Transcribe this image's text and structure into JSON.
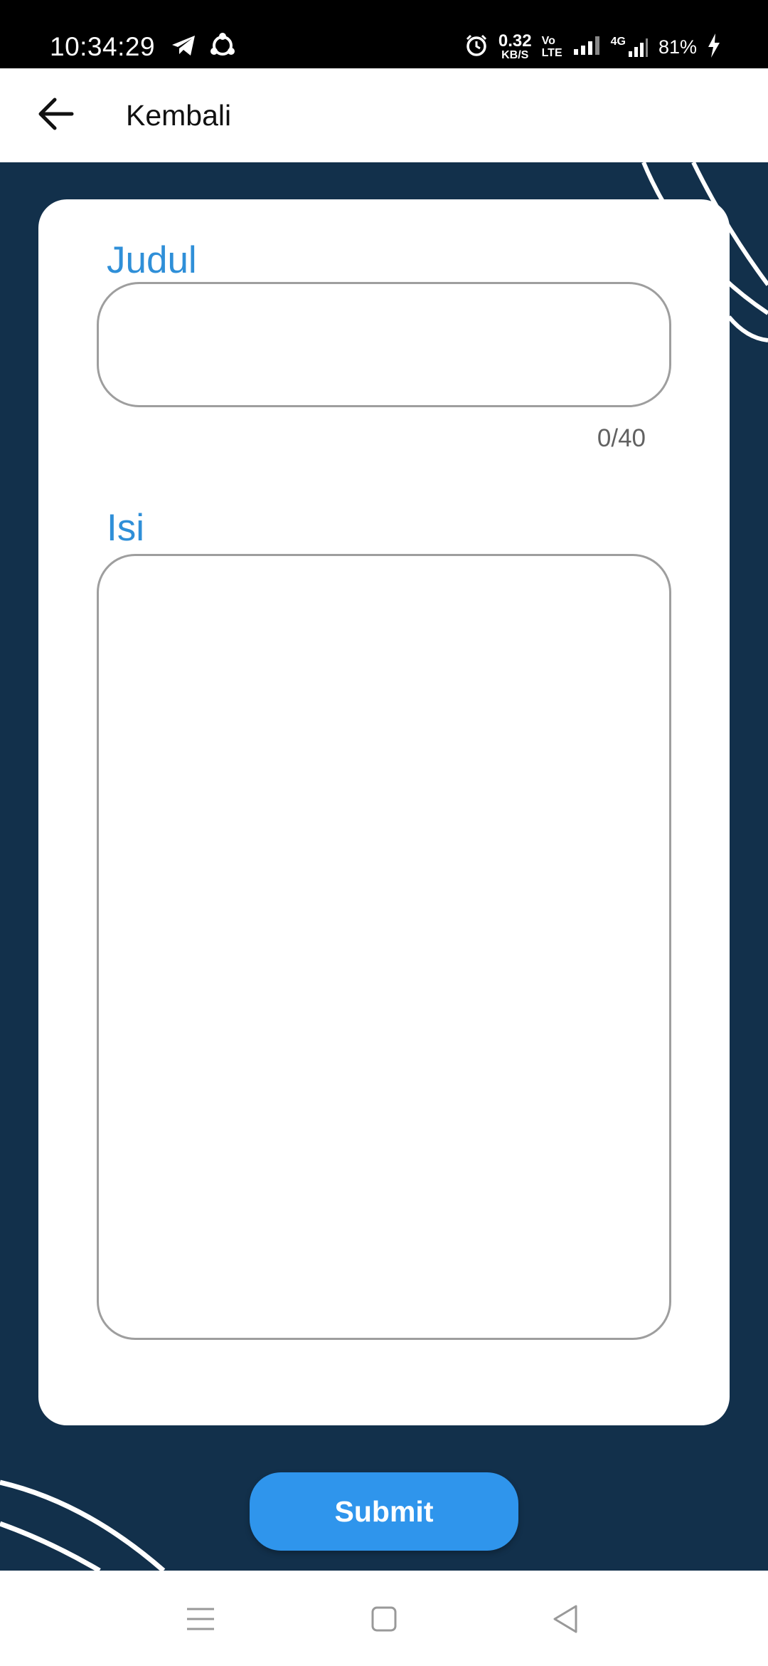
{
  "status_bar": {
    "time": "10:34:29",
    "net_speed_value": "0.32",
    "net_speed_unit": "KB/S",
    "volte_top": "Vo",
    "volte_bottom": "LTE",
    "network_type": "4G",
    "battery": "81%",
    "icons": [
      "telegram-icon",
      "shareit-icon",
      "alarm-icon",
      "signal-icon",
      "signal-4g-icon",
      "charging-icon"
    ]
  },
  "app_bar": {
    "back_icon": "arrow-left-icon",
    "title": "Kembali"
  },
  "form": {
    "title_label": "Judul",
    "title_value": "",
    "title_counter": "0/40",
    "content_label": "Isi",
    "content_value": ""
  },
  "submit_label": "Submit",
  "nav_bar": {
    "icons": [
      "menu-icon",
      "home-square-icon",
      "back-triangle-icon"
    ]
  },
  "colors": {
    "background": "#12304b",
    "accent": "#2f95ec",
    "label": "#2f8fd8",
    "card": "#ffffff"
  }
}
